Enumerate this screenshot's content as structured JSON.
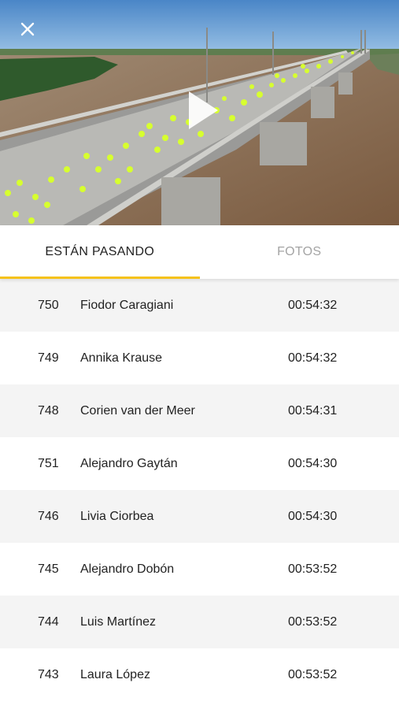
{
  "header": {
    "close_icon": "close-icon",
    "play_icon": "play-icon"
  },
  "tabs": [
    {
      "label": "ESTÁN PASANDO",
      "active": true
    },
    {
      "label": "FOTOS",
      "active": false
    }
  ],
  "colors": {
    "accent": "#f5c21a",
    "row_alt": "#f4f4f4",
    "inactive_tab": "#a4a4a4"
  },
  "runners": [
    {
      "bib": "750",
      "name": "Fiodor Caragiani",
      "time": "00:54:32"
    },
    {
      "bib": "749",
      "name": "Annika Krause",
      "time": "00:54:32"
    },
    {
      "bib": "748",
      "name": "Corien van der Meer",
      "time": "00:54:31"
    },
    {
      "bib": "751",
      "name": "Alejandro Gaytán",
      "time": "00:54:30"
    },
    {
      "bib": "746",
      "name": "Livia Ciorbea",
      "time": "00:54:30"
    },
    {
      "bib": "745",
      "name": "Alejandro Dobón",
      "time": "00:53:52"
    },
    {
      "bib": "744",
      "name": "Luis Martínez",
      "time": "00:53:52"
    },
    {
      "bib": "743",
      "name": "Laura López",
      "time": "00:53:52"
    }
  ]
}
